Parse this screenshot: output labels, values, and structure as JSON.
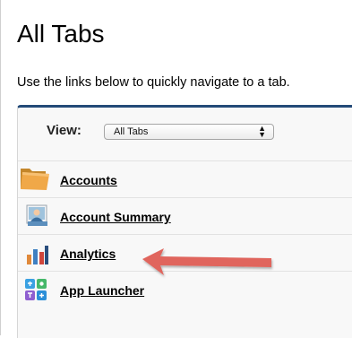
{
  "page": {
    "title": "All Tabs",
    "description": "Use the links below to quickly navigate to a tab."
  },
  "view": {
    "label": "View:",
    "selected": "All Tabs"
  },
  "tabs": [
    {
      "label": "Accounts",
      "icon": "folder-icon"
    },
    {
      "label": "Account Summary",
      "icon": "account-summary-icon"
    },
    {
      "label": "Analytics",
      "icon": "analytics-bar-icon"
    },
    {
      "label": "App Launcher",
      "icon": "app-launcher-grid-icon"
    }
  ],
  "colors": {
    "header_bar": "#234a78",
    "annotation_arrow": "#e0655d"
  }
}
